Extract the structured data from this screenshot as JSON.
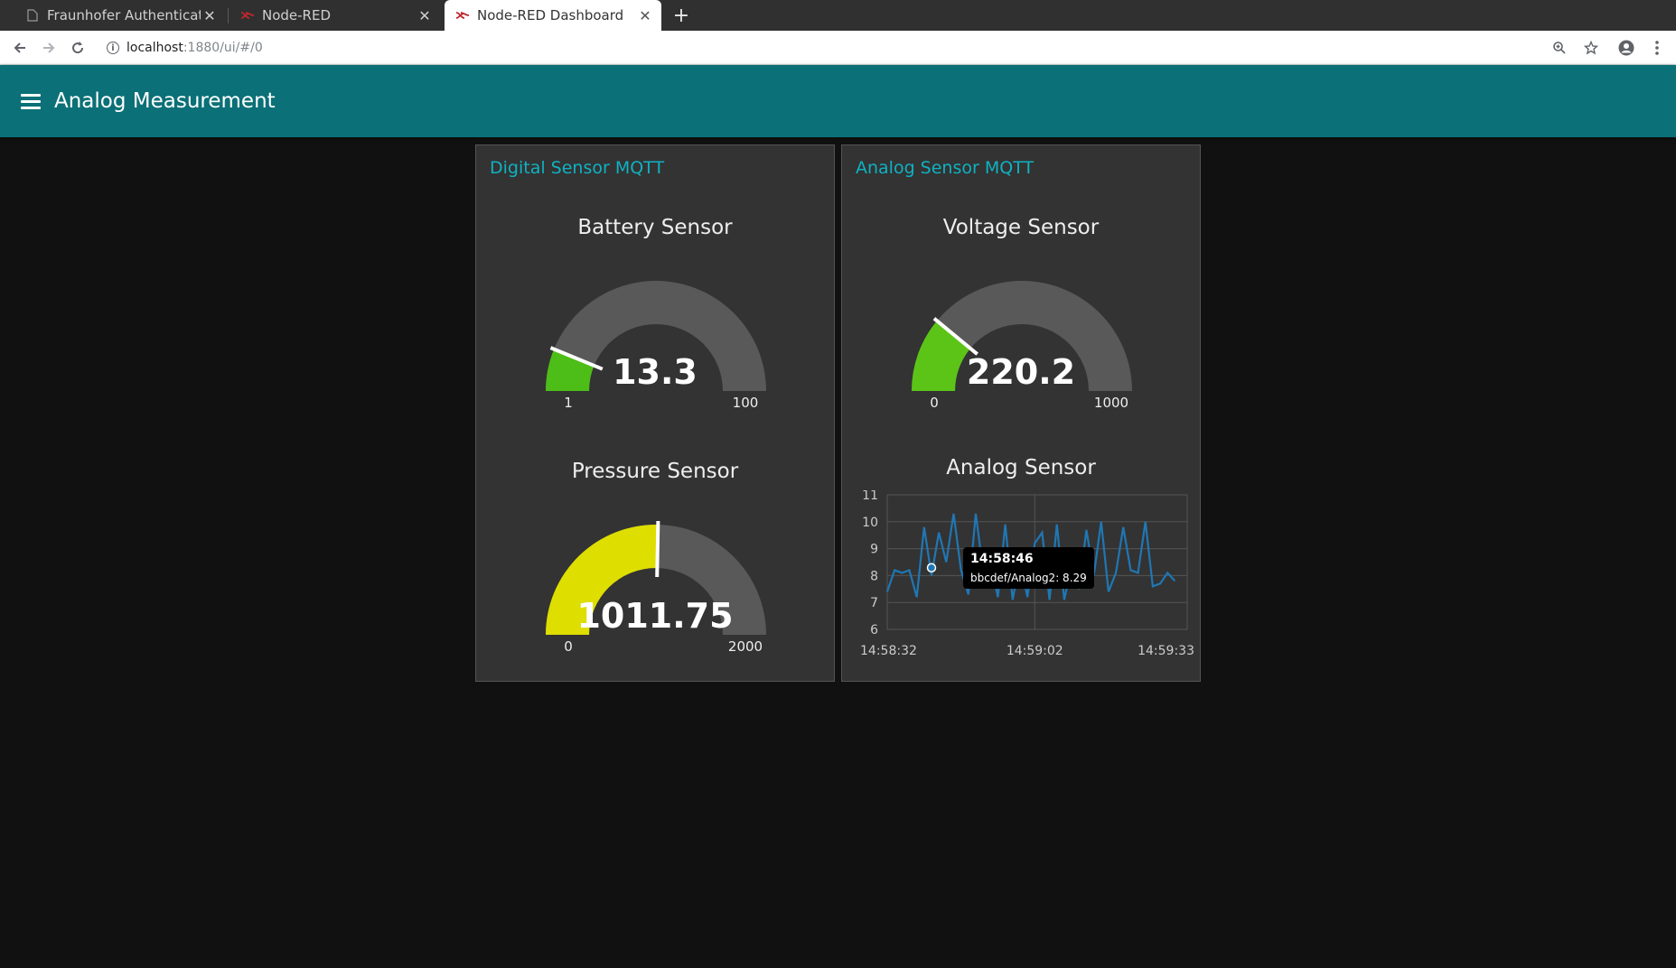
{
  "browser": {
    "tabs": [
      {
        "title": "Fraunhofer Authenticatio",
        "icon": "page-icon"
      },
      {
        "title": "Node-RED",
        "icon": "node-red-icon"
      },
      {
        "title": "Node-RED Dashboard",
        "icon": "node-red-icon"
      }
    ],
    "url_host": "localhost",
    "url_path": ":1880/ui/#/0"
  },
  "header": {
    "title": "Analog Measurement"
  },
  "groups": [
    {
      "title": "Digital Sensor MQTT",
      "widgets": [
        {
          "title": "Battery Sensor",
          "value": "13.3",
          "min": "1",
          "max": "100",
          "fraction": 0.124,
          "color": "#4dbd17"
        },
        {
          "title": "Pressure Sensor",
          "value": "1011.75",
          "min": "0",
          "max": "2000",
          "fraction": 0.506,
          "color": "#dede00"
        }
      ]
    },
    {
      "title": "Analog Sensor MQTT",
      "widgets": [
        {
          "title": "Voltage Sensor",
          "value": "220.2",
          "min": "0",
          "max": "1000",
          "fraction": 0.22,
          "color": "#5cc417"
        }
      ],
      "chart_title": "Analog Sensor"
    }
  ],
  "tooltip": {
    "time": "14:58:46",
    "text": "bbcdef/Analog2: 8.29"
  },
  "chart_data": {
    "type": "line",
    "title": "Analog Sensor",
    "xlabel": "",
    "ylabel": "",
    "ylim": [
      6,
      11
    ],
    "yticks": [
      "11",
      "10",
      "9",
      "8",
      "7",
      "6"
    ],
    "xticks": [
      "14:58:32",
      "14:59:02",
      "14:59:33"
    ],
    "grid": true,
    "series": [
      {
        "color": "#1f77b4",
        "t": [
          0,
          1.5,
          3,
          4.5,
          6,
          7.5,
          9,
          10.5,
          12,
          13.5,
          15,
          16.5,
          18,
          19.5,
          21,
          22.5,
          24,
          25.5,
          27,
          28.5,
          30,
          31.5,
          33,
          34.5,
          36,
          37.5,
          39,
          40.5,
          42,
          43.5,
          45,
          46.5,
          48,
          49.5,
          51,
          52.5,
          54,
          55.5,
          57,
          58.5
        ],
        "values": [
          7.4,
          8.2,
          8.1,
          8.2,
          7.2,
          9.8,
          8.0,
          9.6,
          8.5,
          10.3,
          8.2,
          7.3,
          10.3,
          8.2,
          8.5,
          7.2,
          9.9,
          7.1,
          8.6,
          7.2,
          9.2,
          9.6,
          7.1,
          9.9,
          7.1,
          8.4,
          7.5,
          9.7,
          8.0,
          10.0,
          7.4,
          8.1,
          9.8,
          8.2,
          8.1,
          10.0,
          7.6,
          7.7,
          8.1,
          7.8
        ]
      }
    ]
  }
}
